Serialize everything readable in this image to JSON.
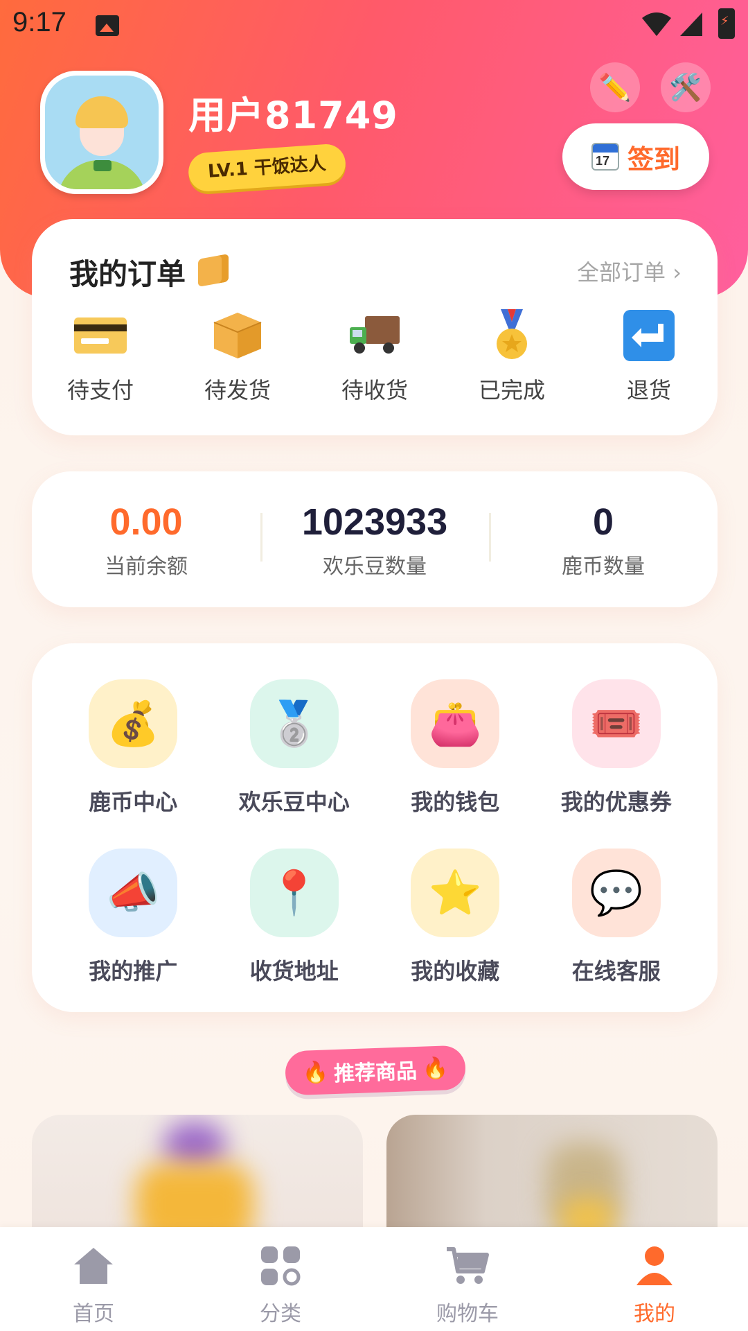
{
  "status_bar": {
    "time": "9:17"
  },
  "profile": {
    "username": "用户81749",
    "level_badge": "LV.1 干饭达人",
    "signin_label": "签到",
    "calendar_day": "17"
  },
  "orders": {
    "title": "我的订单",
    "all_link": "全部订单 ›",
    "items": [
      {
        "label": "待支付",
        "icon": "credit-card-icon"
      },
      {
        "label": "待发货",
        "icon": "package-icon"
      },
      {
        "label": "待收货",
        "icon": "truck-icon"
      },
      {
        "label": "已完成",
        "icon": "medal-icon"
      },
      {
        "label": "退货",
        "icon": "return-arrow-icon"
      }
    ]
  },
  "stats": [
    {
      "value": "0.00",
      "label": "当前余额"
    },
    {
      "value": "1023933",
      "label": "欢乐豆数量"
    },
    {
      "value": "0",
      "label": "鹿币数量"
    }
  ],
  "services": [
    {
      "label": "鹿币中心",
      "icon": "money-bag-icon",
      "bg": "#fff1c9"
    },
    {
      "label": "欢乐豆中心",
      "icon": "medal-2-icon",
      "bg": "#dcf6ec"
    },
    {
      "label": "我的钱包",
      "icon": "purse-icon",
      "bg": "#ffe3d8"
    },
    {
      "label": "我的优惠券",
      "icon": "ticket-icon",
      "bg": "#ffe3ea"
    },
    {
      "label": "我的推广",
      "icon": "megaphone-icon",
      "bg": "#e1efff"
    },
    {
      "label": "收货地址",
      "icon": "pin-icon",
      "bg": "#dcf6ec"
    },
    {
      "label": "我的收藏",
      "icon": "star-icon",
      "bg": "#fff1c9"
    },
    {
      "label": "在线客服",
      "icon": "chat-bubble-icon",
      "bg": "#ffe3d8"
    }
  ],
  "recommend": {
    "label": "推荐商品"
  },
  "tabs": [
    {
      "label": "首页",
      "icon": "home-icon"
    },
    {
      "label": "分类",
      "icon": "category-icon"
    },
    {
      "label": "购物车",
      "icon": "cart-icon"
    },
    {
      "label": "我的",
      "icon": "user-icon"
    }
  ],
  "colors": {
    "accent": "#ff6a2c",
    "hero_start": "#ff6b3d",
    "hero_end": "#ff5f9e"
  }
}
